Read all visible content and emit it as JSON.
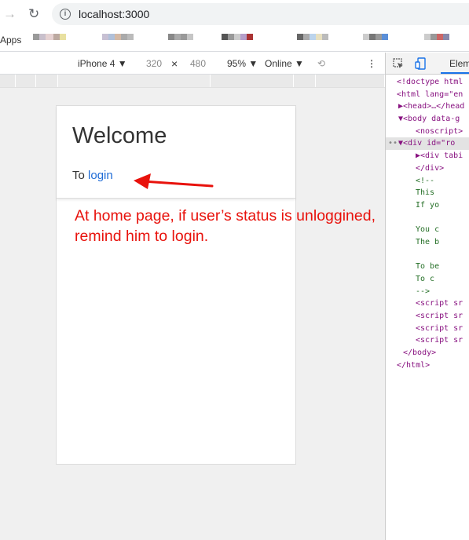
{
  "browser": {
    "url": "localhost:3000",
    "apps_label": "Apps"
  },
  "device_toolbar": {
    "device": "iPhone 4 ▼",
    "width": "320",
    "times": "×",
    "height": "480",
    "zoom": "95% ▼",
    "network": "Online ▼"
  },
  "page": {
    "heading": "Welcome",
    "to_text": "To ",
    "login_link": "login"
  },
  "annotation": {
    "line1": "At home page, if user’s status is unloggined,",
    "line2": "remind him to login.",
    "color": "#e8120c"
  },
  "devtools": {
    "tab_elements": "Elem",
    "lines": [
      "<!doctype html",
      "<html lang=\"en",
      "▶<head>…</head",
      "▼<body data-g",
      "  <noscript>",
      "▼<div id=\"ro",
      "  ▶<div tabi",
      "   </div>",
      "  <!--",
      "       This",
      "       If yo",
      "",
      "       You c",
      "       The b",
      "",
      "       To be",
      "       To c",
      "     -->",
      "  <script sr",
      "  <script sr",
      "  <script sr",
      "  <script sr",
      " </body>",
      "</html>"
    ]
  }
}
